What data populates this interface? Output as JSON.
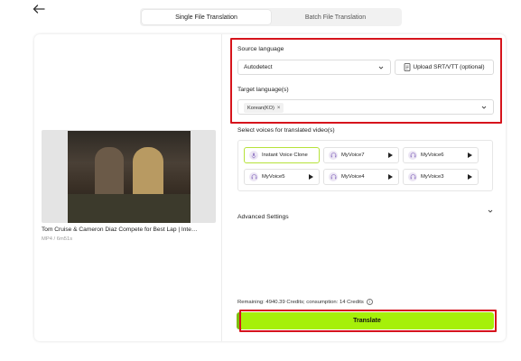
{
  "header": {
    "back_icon": "arrow-left-icon",
    "tabs": [
      {
        "label": "Single File Translation",
        "active": true
      },
      {
        "label": "Batch File Translation",
        "active": false
      }
    ]
  },
  "video": {
    "title": "Tom Cruise & Cameron Diaz Compete for Best Lap | Inte…",
    "meta": "MP4 / 6m51s"
  },
  "source": {
    "label": "Source language",
    "value": "Autodetect",
    "upload_label": "Upload SRT/VTT (optional)"
  },
  "target": {
    "label": "Target language(s)",
    "tags": [
      "Korean(KO)"
    ]
  },
  "voices": {
    "label": "Select voices for translated video(s)",
    "items": [
      {
        "name": "Instant Voice Clone",
        "selected": true
      },
      {
        "name": "MyVoice7"
      },
      {
        "name": "MyVoice6"
      },
      {
        "name": "MyVoice5"
      },
      {
        "name": "MyVoice4"
      },
      {
        "name": "MyVoice3"
      }
    ]
  },
  "advanced": {
    "label": "Advanced Settings"
  },
  "footer": {
    "remaining": "Remaining: 4940.39 Credits; consumption: 14 Credits",
    "translate_label": "Translate"
  },
  "colors": {
    "accent": "#a6f00a",
    "highlight": "#d6141c"
  }
}
